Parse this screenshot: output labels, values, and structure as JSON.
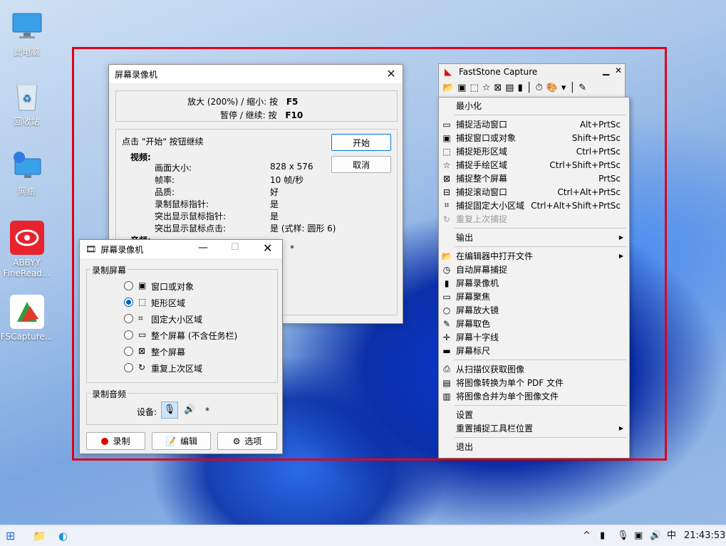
{
  "desktop": {
    "icons": [
      {
        "label": "此电脑"
      },
      {
        "label": "回收站"
      },
      {
        "label": "网络"
      },
      {
        "label": "ABBYY FineRead..."
      },
      {
        "label": "FSCapture..."
      }
    ]
  },
  "recorder_info": {
    "title": "屏幕录像机",
    "zoom_line_label": "放大 (200%) / 缩小: 按",
    "zoom_key": "F5",
    "pause_line_label": "暂停 / 继续: 按",
    "pause_key": "F10",
    "prompt": "点击 \"开始\" 按钮继续",
    "start_button": "开始",
    "cancel_button": "取消",
    "video_heading": "视频:",
    "rows": [
      {
        "k": "画面大小:",
        "v": "828 x 576"
      },
      {
        "k": "帧率:",
        "v": "10 帧/秒"
      },
      {
        "k": "品质:",
        "v": "好"
      },
      {
        "k": "录制鼠标指针:",
        "v": "是"
      },
      {
        "k": "突出显示鼠标指针:",
        "v": "是"
      },
      {
        "k": "突出显示鼠标点击:",
        "v": "是 (式样: 圆形 6)"
      }
    ],
    "audio_heading": "音频:",
    "audio_value": "*"
  },
  "recorder_panel": {
    "title": "屏幕录像机",
    "record_screen_label": "录制屏幕",
    "options": [
      {
        "label": "窗口或对象",
        "selected": false
      },
      {
        "label": "矩形区域",
        "selected": true
      },
      {
        "label": "固定大小区域",
        "selected": false
      },
      {
        "label": "整个屏幕 (不含任务栏)",
        "selected": false
      },
      {
        "label": "整个屏幕",
        "selected": false
      },
      {
        "label": "重复上次区域",
        "selected": false
      }
    ],
    "record_audio_label": "录制音频",
    "device_label": "设备:",
    "device_value": "*",
    "buttons": {
      "record": "录制",
      "edit": "编辑",
      "options": "选项"
    }
  },
  "faststone": {
    "title": "FastStone Capture",
    "menu": [
      {
        "icon": "",
        "label": "最小化",
        "shortcut": ""
      },
      {
        "sep": true
      },
      {
        "icon": "▭",
        "label": "捕捉活动窗口",
        "shortcut": "Alt+PrtSc"
      },
      {
        "icon": "▣",
        "label": "捕捉窗口或对象",
        "shortcut": "Shift+PrtSc"
      },
      {
        "icon": "⬚",
        "label": "捕捉矩形区域",
        "shortcut": "Ctrl+PrtSc"
      },
      {
        "icon": "☆",
        "label": "捕捉手绘区域",
        "shortcut": "Ctrl+Shift+PrtSc"
      },
      {
        "icon": "⊠",
        "label": "捕捉整个屏幕",
        "shortcut": "PrtSc"
      },
      {
        "icon": "⊟",
        "label": "捕捉滚动窗口",
        "shortcut": "Ctrl+Alt+PrtSc"
      },
      {
        "icon": "⌗",
        "label": "捕捉固定大小区域",
        "shortcut": "Ctrl+Alt+Shift+PrtSc"
      },
      {
        "icon": "↻",
        "label": "重复上次捕捉",
        "shortcut": "",
        "disabled": true
      },
      {
        "sep": true
      },
      {
        "icon": "",
        "label": "输出",
        "shortcut": "",
        "submenu": true
      },
      {
        "sep": true
      },
      {
        "icon": "📂",
        "label": "在编辑器中打开文件",
        "shortcut": "",
        "submenu": true
      },
      {
        "icon": "◷",
        "label": "自动屏幕捕捉",
        "shortcut": ""
      },
      {
        "icon": "▮",
        "label": "屏幕录像机",
        "shortcut": ""
      },
      {
        "icon": "▭",
        "label": "屏幕聚焦",
        "shortcut": ""
      },
      {
        "icon": "○",
        "label": "屏幕放大镜",
        "shortcut": ""
      },
      {
        "icon": "✎",
        "label": "屏幕取色",
        "shortcut": ""
      },
      {
        "icon": "✛",
        "label": "屏幕十字线",
        "shortcut": ""
      },
      {
        "icon": "▬",
        "label": "屏幕标尺",
        "shortcut": ""
      },
      {
        "sep": true
      },
      {
        "icon": "⎙",
        "label": "从扫描仪获取图像",
        "shortcut": ""
      },
      {
        "icon": "▤",
        "label": "将图像转换为单个 PDF 文件",
        "shortcut": ""
      },
      {
        "icon": "▥",
        "label": "将图像合并为单个图像文件",
        "shortcut": ""
      },
      {
        "sep": true
      },
      {
        "icon": "",
        "label": "设置",
        "shortcut": ""
      },
      {
        "icon": "",
        "label": "重置捕捉工具栏位置",
        "shortcut": "",
        "submenu": true
      },
      {
        "sep": true
      },
      {
        "icon": "",
        "label": "退出",
        "shortcut": ""
      }
    ]
  },
  "taskbar": {
    "time": "21:43:53",
    "ime": "中"
  },
  "colors": {
    "capture_border": "#e0001a",
    "accent": "#005fb8"
  }
}
